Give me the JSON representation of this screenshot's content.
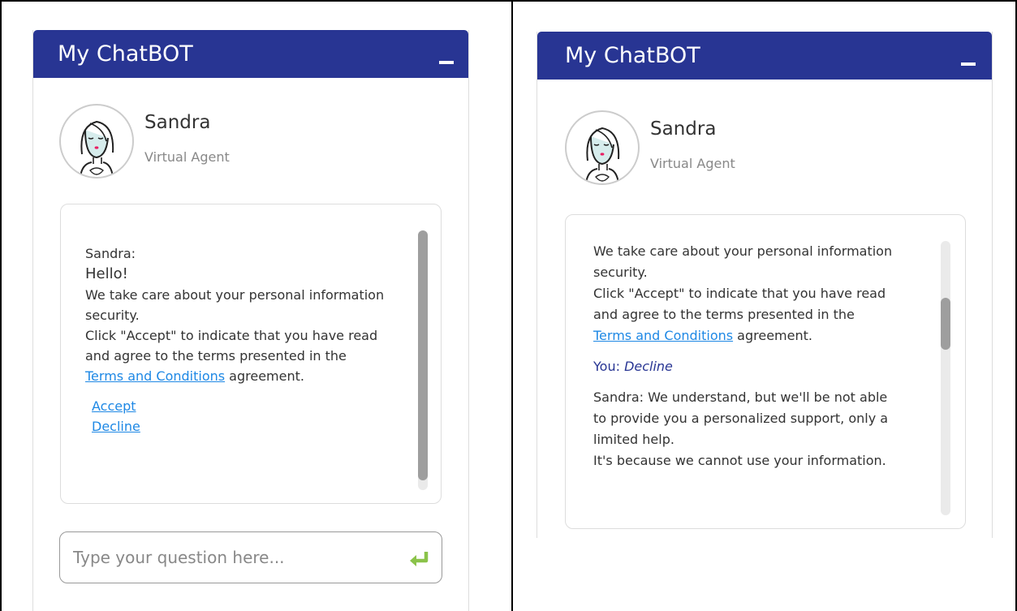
{
  "colors": {
    "header": "#283593",
    "link": "#1e88e5",
    "send_icon": "#8bc34a",
    "you_text": "#283593"
  },
  "left": {
    "header": {
      "title": "My ChatBOT"
    },
    "agent": {
      "name": "Sandra",
      "role": "Virtual Agent"
    },
    "messages": {
      "sender": "Sandra:",
      "greeting": "Hello!",
      "line1": "We take care about your personal information",
      "line2": "security.",
      "line3": "Click \"Accept\" to indicate that you have read",
      "line4": "and agree to the terms presented in the",
      "terms_link": "Terms and Conditions",
      "terms_suffix": " agreement.",
      "options": [
        "Accept",
        "Decline"
      ]
    },
    "input": {
      "placeholder": "Type your question here..."
    }
  },
  "right": {
    "header": {
      "title": "My ChatBOT"
    },
    "agent": {
      "name": "Sandra",
      "role": "Virtual Agent"
    },
    "messages": {
      "line1": "We take care about your personal information",
      "line2": "security.",
      "line3": "Click \"Accept\" to indicate that you have read",
      "line4": "and agree to the terms presented in the",
      "terms_link": "Terms and Conditions",
      "terms_suffix": " agreement.",
      "you_label": "You: ",
      "you_answer": "Decline",
      "reply_sender": "Sandra:",
      "reply1": " We understand, but we'll be not able",
      "reply2": "to provide you a personalized support, only a",
      "reply3": "limited help.",
      "reply4": "It's because we cannot use your information."
    }
  }
}
